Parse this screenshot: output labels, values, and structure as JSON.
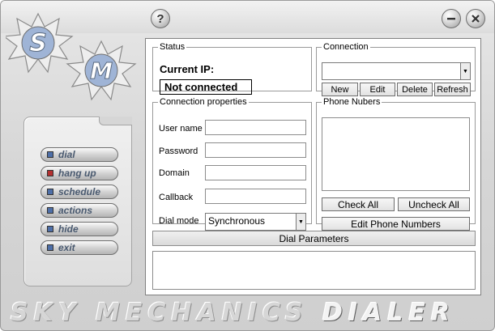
{
  "window": {
    "help_label": "?",
    "brand_part1": "SKY MECHANICS ",
    "brand_part2": "DIALER"
  },
  "logo": {
    "letter1": "S",
    "letter2": "M"
  },
  "nav": {
    "items": [
      {
        "label": "dial",
        "led": "blue"
      },
      {
        "label": "hang up",
        "led": "red"
      },
      {
        "label": "schedule",
        "led": "blue"
      },
      {
        "label": "actions",
        "led": "blue"
      },
      {
        "label": "hide",
        "led": "blue"
      },
      {
        "label": "exit",
        "led": "blue"
      }
    ]
  },
  "status": {
    "legend": "Status",
    "current_ip_label": "Current IP:",
    "ip_value": "Not connected"
  },
  "connection": {
    "legend": "Connection",
    "selected": "",
    "buttons": {
      "new": "New",
      "edit": "Edit",
      "delete": "Delete",
      "refresh": "Refresh"
    }
  },
  "connection_properties": {
    "legend": "Connection properties",
    "fields": {
      "username_label": "User name",
      "username_value": "",
      "password_label": "Password",
      "password_value": "",
      "domain_label": "Domain",
      "domain_value": "",
      "callback_label": "Callback",
      "callback_value": "",
      "dial_mode_label": "Dial mode",
      "dial_mode_value": "Synchronous"
    }
  },
  "phone_numbers": {
    "legend": "Phone Nubers",
    "check_all": "Check All",
    "uncheck_all": "Uncheck All",
    "edit_phone_numbers": "Edit Phone Numbers"
  },
  "dial_parameters": {
    "label": "Dial Parameters"
  },
  "colors": {
    "accent_blue": "#4e6fa8",
    "led_red": "#b43030",
    "skin": "#d6d6d6"
  }
}
